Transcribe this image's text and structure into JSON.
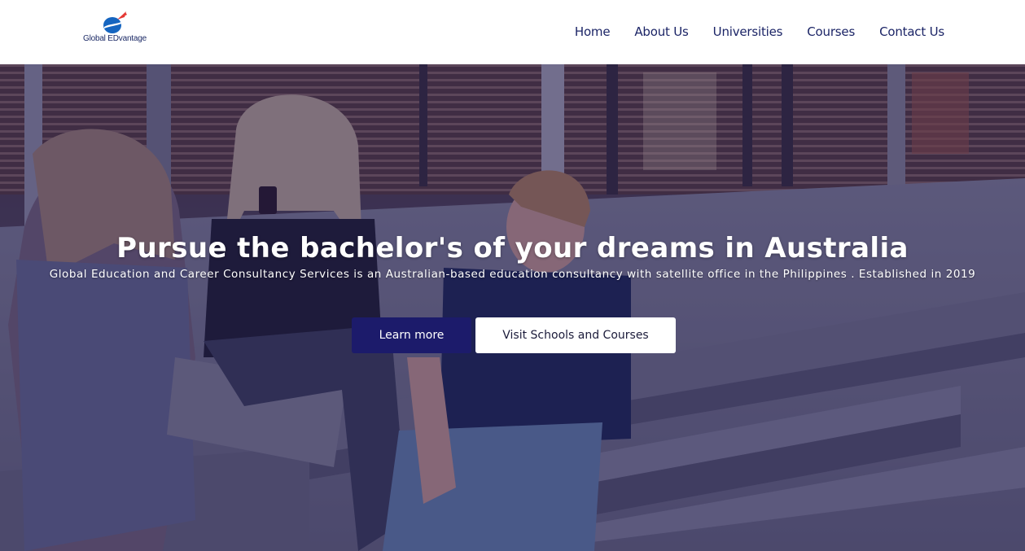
{
  "header": {
    "logo_text": "Global EDvantage",
    "nav": [
      {
        "label": "Home"
      },
      {
        "label": "About Us"
      },
      {
        "label": "Universities"
      },
      {
        "label": "Courses"
      },
      {
        "label": "Contact Us"
      }
    ]
  },
  "hero": {
    "title": "Pursue the bachelor's of your dreams in Australia",
    "subtitle": "Global Education and Career Consultancy Services is an Australian-based education consultancy with satellite office in the Philippines . Established in 2019",
    "learn_more_label": "Learn more",
    "visit_label": "Visit Schools and Courses"
  },
  "colors": {
    "nav_text": "#1b2466",
    "overlay": "#1c165c",
    "primary_button": "#1c1b6b",
    "logo_blue": "#1565c0",
    "logo_red": "#e53935"
  }
}
